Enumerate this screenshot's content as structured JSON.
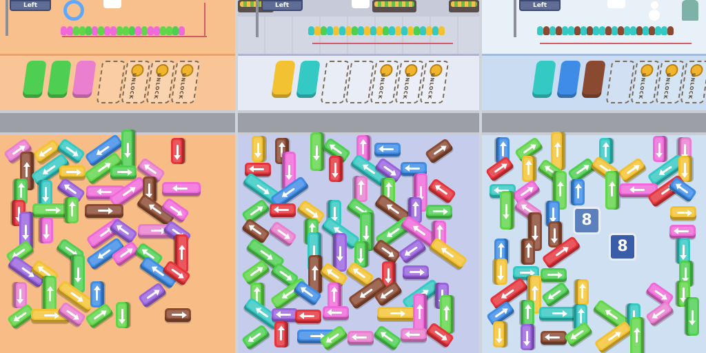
{
  "panels": [
    {
      "theme": "orange",
      "sign_text": "Left",
      "locked_slots": [
        "UNLOCK",
        "UNLOCK",
        "UNLOCK"
      ],
      "colors": {
        "ground_top": "#f6b97f",
        "platform": "#f4c89b",
        "board": "#f9bd86"
      }
    },
    {
      "theme": "city",
      "sign_text": "Left",
      "locked_slots": [
        "UNLOCK",
        "UNLOCK",
        "UNLOCK"
      ],
      "colors": {
        "ground_top": "#d7dae6",
        "platform": "#e4e8f3",
        "board": "#c9cfec"
      }
    },
    {
      "theme": "snow",
      "sign_text": "Left",
      "locked_slots": [
        "UNLOCK",
        "UNLOCK",
        "UNLOCK"
      ],
      "badge_values": [
        "8",
        "8"
      ],
      "colors": {
        "ground_top": "#dbe9f6",
        "platform": "#c8dbf0",
        "board": "#cfe0f2"
      }
    }
  ],
  "palette": {
    "green": "#4fcf52",
    "pink": "#ea7fcf",
    "purple": "#9a63de",
    "red": "#e5343c",
    "blue": "#3f8ce6",
    "cyan": "#35c9c4",
    "yellow": "#f3c232",
    "brown": "#8a4a32",
    "lime": "#62d64a",
    "magenta": "#ef6ad8"
  }
}
